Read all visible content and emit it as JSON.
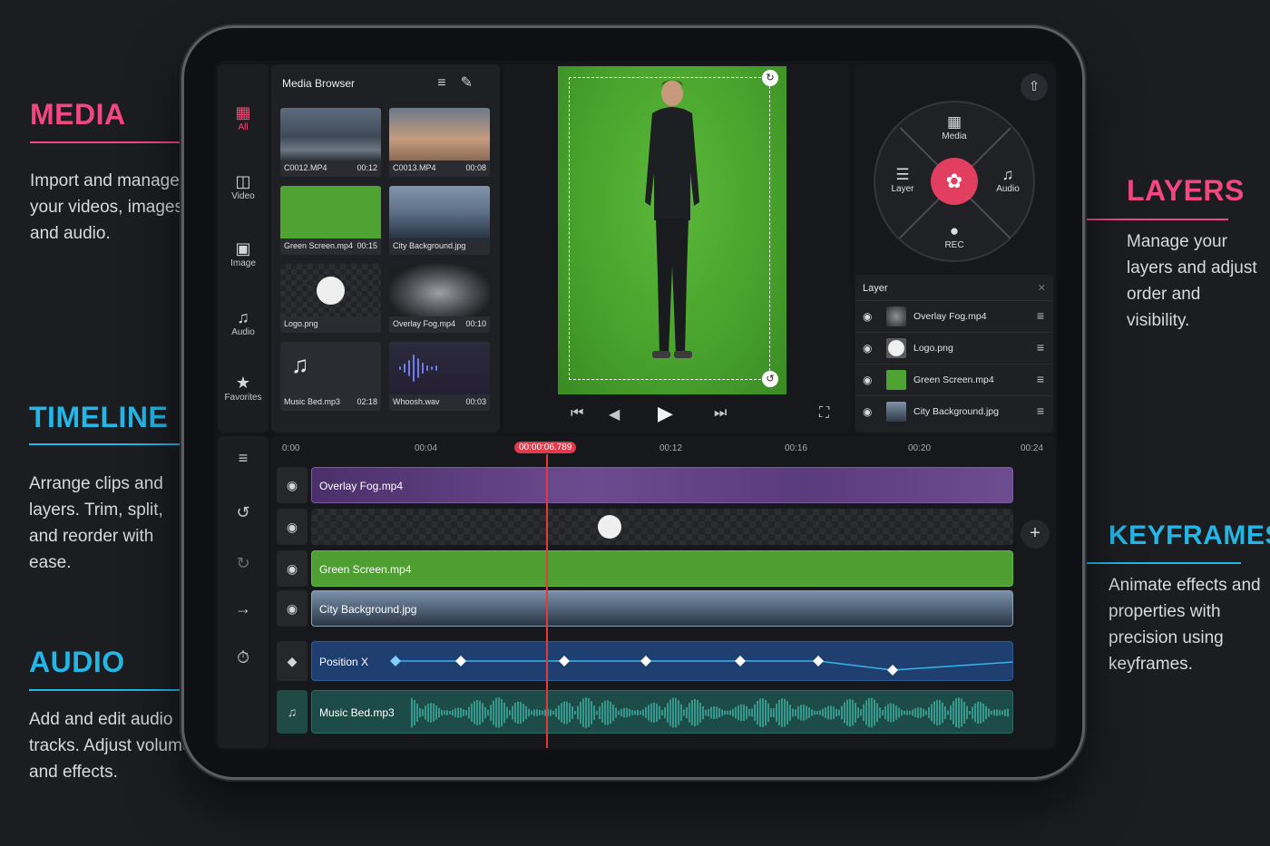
{
  "callouts": {
    "media": {
      "title": "MEDIA",
      "body": "Import and manage your videos, images, and audio."
    },
    "timeline": {
      "title": "TIMELINE",
      "body": "Arrange clips and layers. Trim, split, and reorder with ease."
    },
    "audio": {
      "title": "AUDIO",
      "body": "Add and edit audio tracks. Adjust volume and effects."
    },
    "layers": {
      "title": "LAYERS",
      "body": "Manage your layers and adjust order and visibility."
    },
    "keyframes": {
      "title": "KEYFRAMES",
      "body": "Animate effects and properties with precision using keyframes."
    }
  },
  "colors": {
    "pink": "#f2487f",
    "cyan": "#25b6e6",
    "playhead": "#e2393f",
    "record": "#e23e60"
  },
  "rail": {
    "items": [
      {
        "label": "All",
        "icon": "all-media-icon"
      },
      {
        "label": "Video",
        "icon": "film-icon"
      },
      {
        "label": "Image",
        "icon": "image-icon"
      },
      {
        "label": "Audio",
        "icon": "music-note-icon"
      },
      {
        "label": "Favorites",
        "icon": "star-icon"
      }
    ]
  },
  "media_browser": {
    "title": "Media Browser",
    "items": [
      {
        "name": "C0012.MP4",
        "duration": "00:12"
      },
      {
        "name": "C0013.MP4",
        "duration": "00:08"
      },
      {
        "name": "Green Screen.mp4",
        "duration": "00:15"
      },
      {
        "name": "City Background.jpg",
        "duration": ""
      },
      {
        "name": "Logo.png",
        "duration": ""
      },
      {
        "name": "Overlay Fog.mp4",
        "duration": "00:10"
      },
      {
        "name": "Music Bed.mp3",
        "duration": "02:18"
      },
      {
        "name": "Whoosh.wav",
        "duration": "00:03"
      }
    ]
  },
  "wheel": {
    "items": [
      {
        "label": "Media",
        "icon": "media-icon"
      },
      {
        "label": "Layer",
        "icon": "layers-icon"
      },
      {
        "label": "Audio",
        "icon": "music-note-icon"
      },
      {
        "label": "REC",
        "icon": "microphone-icon"
      }
    ]
  },
  "layer_panel": {
    "title": "Layer",
    "rows": [
      {
        "name": "Overlay Fog.mp4"
      },
      {
        "name": "Logo.png"
      },
      {
        "name": "Green Screen.mp4"
      },
      {
        "name": "City Background.jpg"
      }
    ]
  },
  "timeline": {
    "ticks": [
      "0:00",
      "00:04",
      "00:12",
      "00:16",
      "00:20",
      "00:24"
    ],
    "playhead_time": "00:00:06.789",
    "tracks": [
      {
        "label": "Overlay Fog.mp4"
      },
      {
        "label": ""
      },
      {
        "label": "Green Screen.mp4"
      },
      {
        "label": "City Background.jpg"
      },
      {
        "label": "Position X"
      },
      {
        "label": "Music Bed.mp3"
      }
    ]
  }
}
